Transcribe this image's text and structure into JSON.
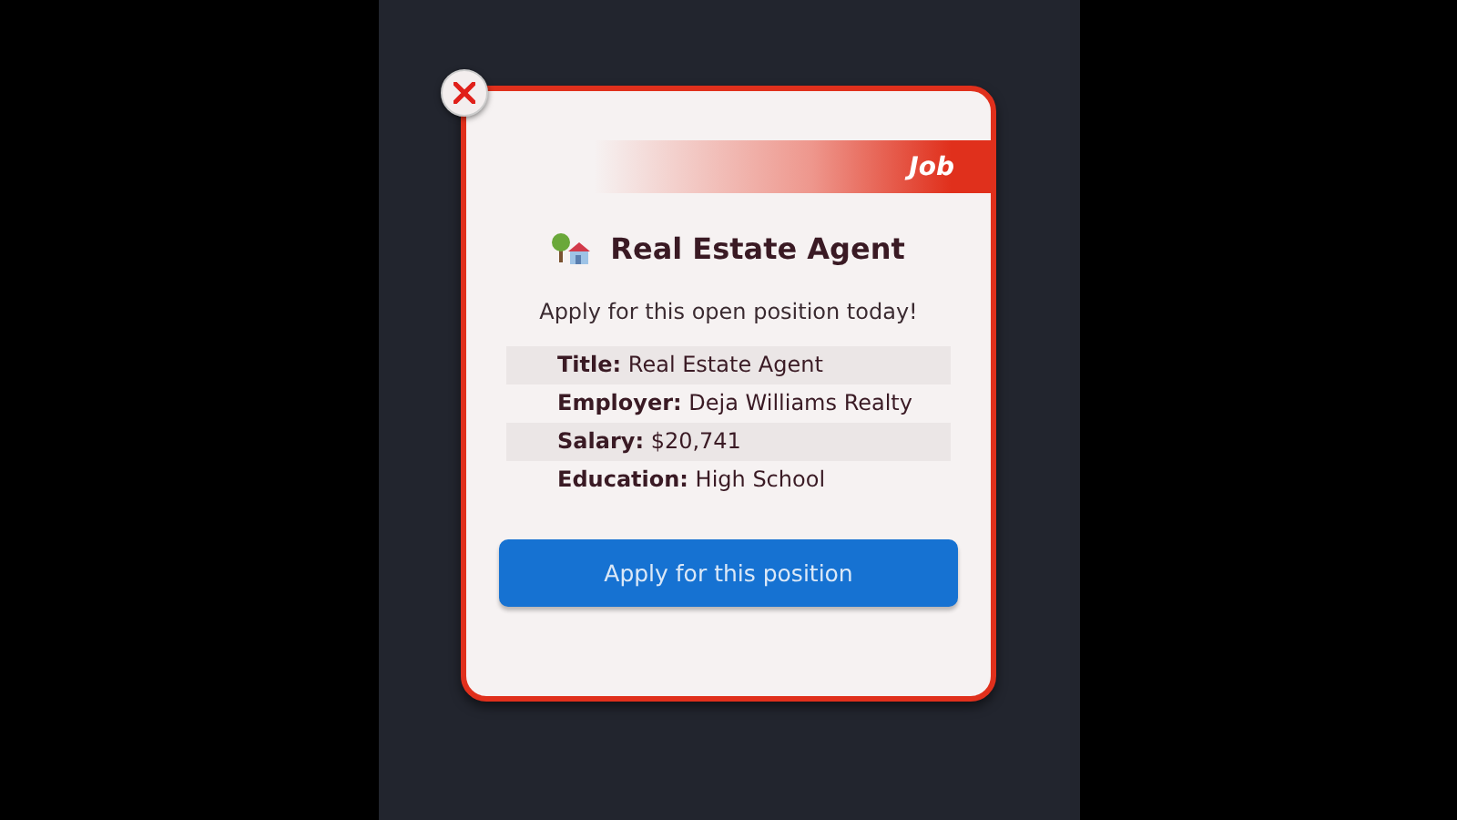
{
  "popup": {
    "tag": "Job",
    "title": "Real Estate Agent",
    "subtitle": "Apply for this open position today!",
    "details": [
      {
        "label": "Title:",
        "value": "Real Estate Agent"
      },
      {
        "label": "Employer:",
        "value": "Deja Williams Realty"
      },
      {
        "label": "Salary:",
        "value": "$20,741"
      },
      {
        "label": "Education:",
        "value": "High School"
      }
    ],
    "button": "Apply for this position"
  }
}
